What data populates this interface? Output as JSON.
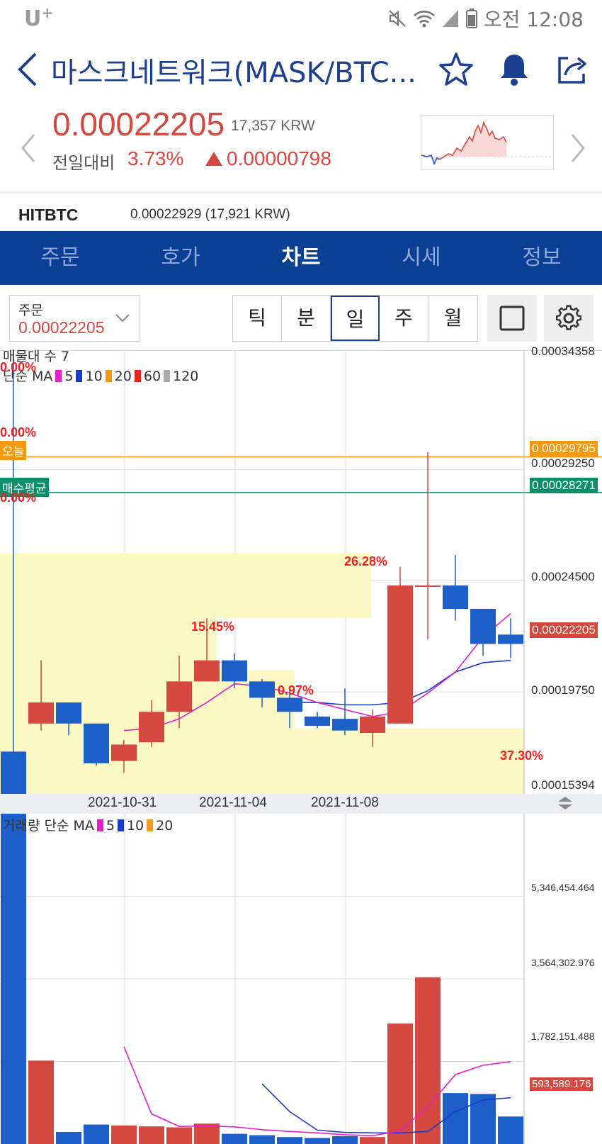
{
  "status_bar": {
    "carrier": "U",
    "carrier_plus": "+",
    "time": "오전 12:08",
    "icons": [
      "mute-icon",
      "wifi-icon",
      "signal-icon",
      "battery-icon"
    ]
  },
  "header": {
    "title": "마스크네트워크(MASK/BTC...",
    "icons": [
      "back-icon",
      "star-icon",
      "bell-icon",
      "share-icon"
    ]
  },
  "price": {
    "current": "0.00022205",
    "krw": "17,357 KRW",
    "change_label": "전일대비",
    "change_pct": "3.73%",
    "change_abs": "0.00000798"
  },
  "exchange": {
    "name": "HITBTC",
    "price": "0.00022929 (17,921 KRW)"
  },
  "tabs": [
    {
      "label": "주문",
      "active": false
    },
    {
      "label": "호가",
      "active": false
    },
    {
      "label": "차트",
      "active": true
    },
    {
      "label": "시세",
      "active": false
    },
    {
      "label": "정보",
      "active": false
    }
  ],
  "toolbar": {
    "order_label": "주문",
    "order_value": "0.00022205",
    "periods": [
      {
        "label": "틱",
        "active": false
      },
      {
        "label": "분",
        "active": false
      },
      {
        "label": "일",
        "active": true
      },
      {
        "label": "주",
        "active": false
      },
      {
        "label": "월",
        "active": false
      }
    ]
  },
  "price_chart": {
    "legend_line1": "매물대 수 7",
    "legend_line2_prefix": "단순 MA",
    "ma_periods": [
      "5",
      "10",
      "20",
      "60",
      "120"
    ],
    "ma_colors": [
      "#e61ec8",
      "#1a3cc8",
      "#f39a12",
      "#ee2222",
      "#aaaaaa"
    ],
    "y_axis_labels": [
      "0.00034358",
      "0.00029250",
      "0.00024500",
      "0.00019750",
      "0.00015394"
    ],
    "today_tag": "오늘",
    "today_value": "0.00029795",
    "avg_tag": "매수평균",
    "avg_value": "0.00028271",
    "last_value": "0.00022205",
    "pct_labels": [
      "0.00%",
      "0.00%",
      "0.00%",
      "26.28%",
      "15.45%",
      "0.97%",
      "37.30%"
    ],
    "date_labels": [
      "2021-10-31",
      "2021-11-04",
      "2021-11-08"
    ]
  },
  "volume_chart": {
    "legend_prefix": "거래량 단순 MA",
    "ma_periods": [
      "5",
      "10",
      "20"
    ],
    "ma_colors": [
      "#e61ec8",
      "#1a3cc8",
      "#f39a12"
    ],
    "y_axis_labels": [
      "5,346,454.464",
      "3,564,302.976",
      "1,782,151.488"
    ],
    "last_value": "593,589.176"
  },
  "chart_data": {
    "type": "candlestick",
    "interval": "daily",
    "colors": {
      "up": "#d4483f",
      "down": "#1d5fc8"
    },
    "ylim": [
      0.00015394,
      0.00034358
    ],
    "candles": [
      {
        "open": 0.000172,
        "close": 0.000135,
        "high": 0.000345,
        "low": 0.000135
      },
      {
        "open": 0.000184,
        "close": 0.000193,
        "high": 0.000211,
        "low": 0.000181
      },
      {
        "open": 0.000193,
        "close": 0.000184,
        "high": 0.000193,
        "low": 0.000179
      },
      {
        "open": 0.000184,
        "close": 0.000167,
        "high": 0.000184,
        "low": 0.000166
      },
      {
        "open": 0.000168,
        "close": 0.000175,
        "high": 0.000177,
        "low": 0.000163
      },
      {
        "open": 0.000176,
        "close": 0.000189,
        "high": 0.000194,
        "low": 0.000174
      },
      {
        "open": 0.000189,
        "close": 0.000202,
        "high": 0.000213,
        "low": 0.000182
      },
      {
        "open": 0.000202,
        "close": 0.000211,
        "high": 0.000229,
        "low": 0.000202
      },
      {
        "open": 0.000211,
        "close": 0.000202,
        "high": 0.000214,
        "low": 0.000199
      },
      {
        "open": 0.000202,
        "close": 0.000195,
        "high": 0.000203,
        "low": 0.000191
      },
      {
        "open": 0.000195,
        "close": 0.000189,
        "high": 0.000199,
        "low": 0.000182
      },
      {
        "open": 0.000187,
        "close": 0.000183,
        "high": 0.000189,
        "low": 0.000182
      },
      {
        "open": 0.000186,
        "close": 0.000181,
        "high": 0.000199,
        "low": 0.000179
      },
      {
        "open": 0.00018,
        "close": 0.000187,
        "high": 0.00019,
        "low": 0.000174
      },
      {
        "open": 0.000184,
        "close": 0.000243,
        "high": 0.000251,
        "low": 0.000184
      },
      {
        "open": 0.000243,
        "close": 0.000243,
        "high": 0.0003,
        "low": 0.00022
      },
      {
        "open": 0.000243,
        "close": 0.000233,
        "high": 0.000256,
        "low": 0.000228
      },
      {
        "open": 0.000233,
        "close": 0.000218,
        "high": 0.000233,
        "low": 0.000213
      },
      {
        "open": 0.000222,
        "close": 0.000218,
        "high": 0.000229,
        "low": 0.000212
      }
    ],
    "ma5": [
      null,
      null,
      null,
      null,
      0.000181,
      0.000182,
      0.000186,
      0.000193,
      0.000201,
      0.0002,
      0.000197,
      0.000193,
      0.00019,
      0.000187,
      0.000189,
      0.000197,
      0.000206,
      0.000221,
      0.000231
    ],
    "ma10": [
      null,
      null,
      null,
      null,
      null,
      null,
      null,
      null,
      null,
      null,
      0.000193,
      0.000193,
      0.000192,
      0.000192,
      0.000193,
      0.000198,
      0.000206,
      0.00021,
      0.000211
    ],
    "volumes": [
      7500000,
      1800000,
      260000,
      420000,
      400000,
      380000,
      360000,
      440000,
      220000,
      190000,
      150000,
      130000,
      170000,
      150000,
      2600000,
      3600000,
      1100000,
      1080000,
      593589.176
    ],
    "volume_ylim": [
      0,
      7130000
    ],
    "vol_ma5": [
      null,
      null,
      null,
      null,
      2100000,
      650000,
      380000,
      390000,
      370000,
      310000,
      270000,
      240000,
      200000,
      180000,
      280000,
      800000,
      1500000,
      1700000,
      1780000
    ],
    "vol_ma10": [
      null,
      null,
      null,
      null,
      null,
      null,
      null,
      null,
      null,
      1300000,
      700000,
      300000,
      250000,
      240000,
      240000,
      270000,
      700000,
      950000,
      1000000
    ],
    "supply_zones_pct": [
      "0.00%",
      "0.00%",
      "0.00%",
      "26.28%",
      "15.45%",
      "0.97%",
      "37.30%"
    ]
  }
}
